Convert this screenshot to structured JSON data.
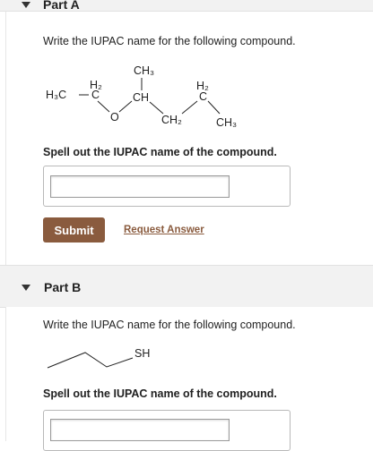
{
  "part_a": {
    "title": "Part A",
    "prompt": "Write the IUPAC name for the following compound.",
    "spell_prompt": "Spell out the IUPAC name of the compound.",
    "input_value": "",
    "submit_label": "Submit",
    "request_label": "Request Answer",
    "structure_labels": {
      "h3c": "H₃C",
      "c_left": "C",
      "h2_left": "H₂",
      "o": "O",
      "ch3_top": "CH₃",
      "ch": "CH",
      "ch2": "CH₂",
      "h2_right": "H₂",
      "c_right": "C",
      "ch3_right": "CH₃"
    }
  },
  "part_b": {
    "title": "Part B",
    "prompt": "Write the IUPAC name for the following compound.",
    "sh_label": "SH",
    "spell_prompt": "Spell out the IUPAC name of the compound.",
    "input_value": ""
  },
  "colors": {
    "submit_bg": "#8a5b3e",
    "link": "#8a5b3e",
    "header_bg": "#f2f2f2"
  }
}
